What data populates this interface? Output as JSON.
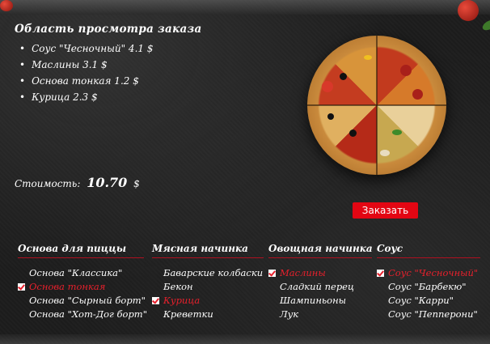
{
  "preview": {
    "title": "Область просмотра заказа",
    "items": [
      "Соус \"Чесночный\" 4.1 $",
      "Маслины 3.1 $",
      "Основа тонкая 1.2 $",
      "Курица 2.3 $"
    ]
  },
  "cost": {
    "label": "Стоимость:",
    "value": "10.70",
    "currency": "$"
  },
  "order_button": "Заказать",
  "colors": {
    "accent": "#e30613",
    "selected_text": "#e8202c",
    "background": "#1b1b1b"
  },
  "columns": [
    {
      "title": "Основа для пиццы",
      "options": [
        {
          "label": "Основа \"Классика\"",
          "checked": false
        },
        {
          "label": "Основа тонкая",
          "checked": true
        },
        {
          "label": "Основа \"Сырный борт\"",
          "checked": false
        },
        {
          "label": "Основа \"Хот-Дог борт\"",
          "checked": false
        }
      ]
    },
    {
      "title": "Мясная начинка",
      "options": [
        {
          "label": "Баварские колбаски",
          "checked": false
        },
        {
          "label": "Бекон",
          "checked": false
        },
        {
          "label": "Курица",
          "checked": true
        },
        {
          "label": "Креветки",
          "checked": false
        }
      ]
    },
    {
      "title": "Овощная начинка",
      "options": [
        {
          "label": "Маслины",
          "checked": true
        },
        {
          "label": "Сладкий перец",
          "checked": false
        },
        {
          "label": "Шампиньоны",
          "checked": false
        },
        {
          "label": "Лук",
          "checked": false
        }
      ]
    },
    {
      "title": "Соус",
      "options": [
        {
          "label": "Соус \"Чесночный\"",
          "checked": true
        },
        {
          "label": "Соус \"Барбекю\"",
          "checked": false
        },
        {
          "label": "Соус \"Карри\"",
          "checked": false
        },
        {
          "label": "Соус \"Пепперони\"",
          "checked": false
        }
      ]
    }
  ]
}
